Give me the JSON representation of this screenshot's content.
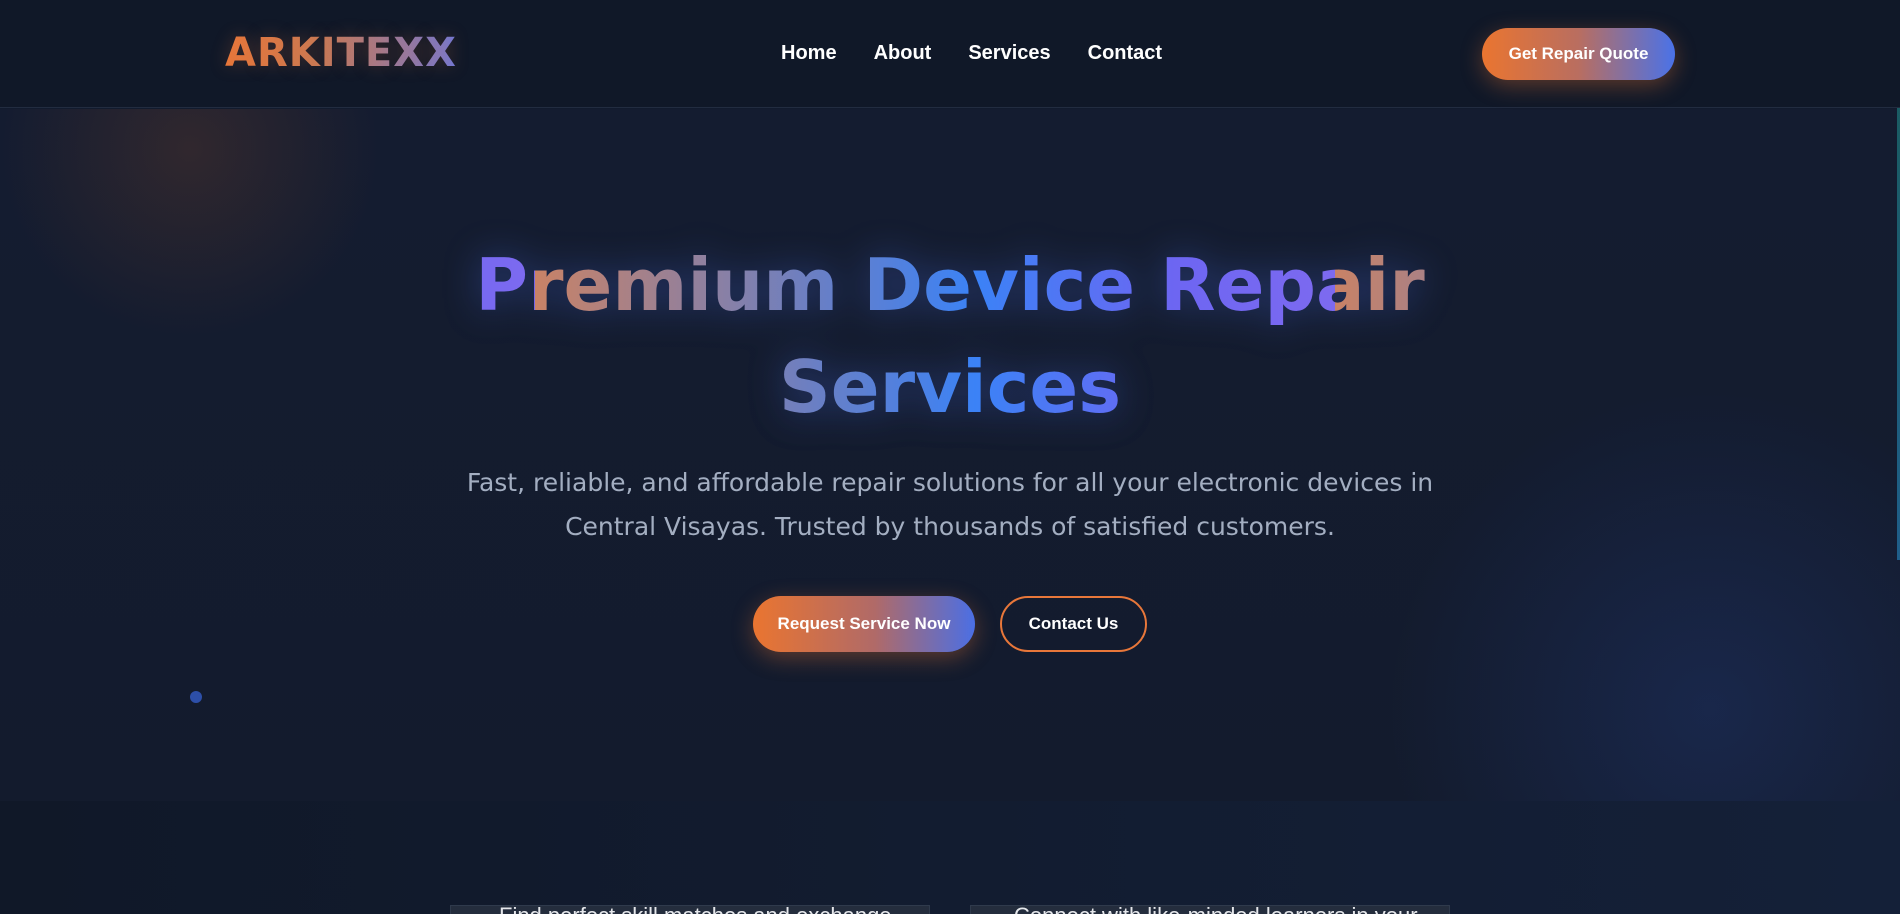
{
  "header": {
    "logo": "ARKITEXX",
    "nav": [
      {
        "label": "Home"
      },
      {
        "label": "About"
      },
      {
        "label": "Services"
      },
      {
        "label": "Contact"
      }
    ],
    "cta_label": "Get Repair Quote"
  },
  "hero": {
    "title_line1": "Premium Device Repair",
    "title_line2": "Services",
    "subtitle": "Fast, reliable, and affordable repair solutions for all your electronic devices in Central Visayas. Trusted by thousands of satisfied customers.",
    "primary_button": "Request Service Now",
    "secondary_button": "Contact Us"
  },
  "features": [
    {
      "text": "Find perfect skill matches and exchange"
    },
    {
      "text": "Connect with like-minded learners in your"
    }
  ],
  "colors": {
    "accent_orange": "#e8773a",
    "accent_blue": "#3b82f6",
    "background": "#121b2e"
  }
}
